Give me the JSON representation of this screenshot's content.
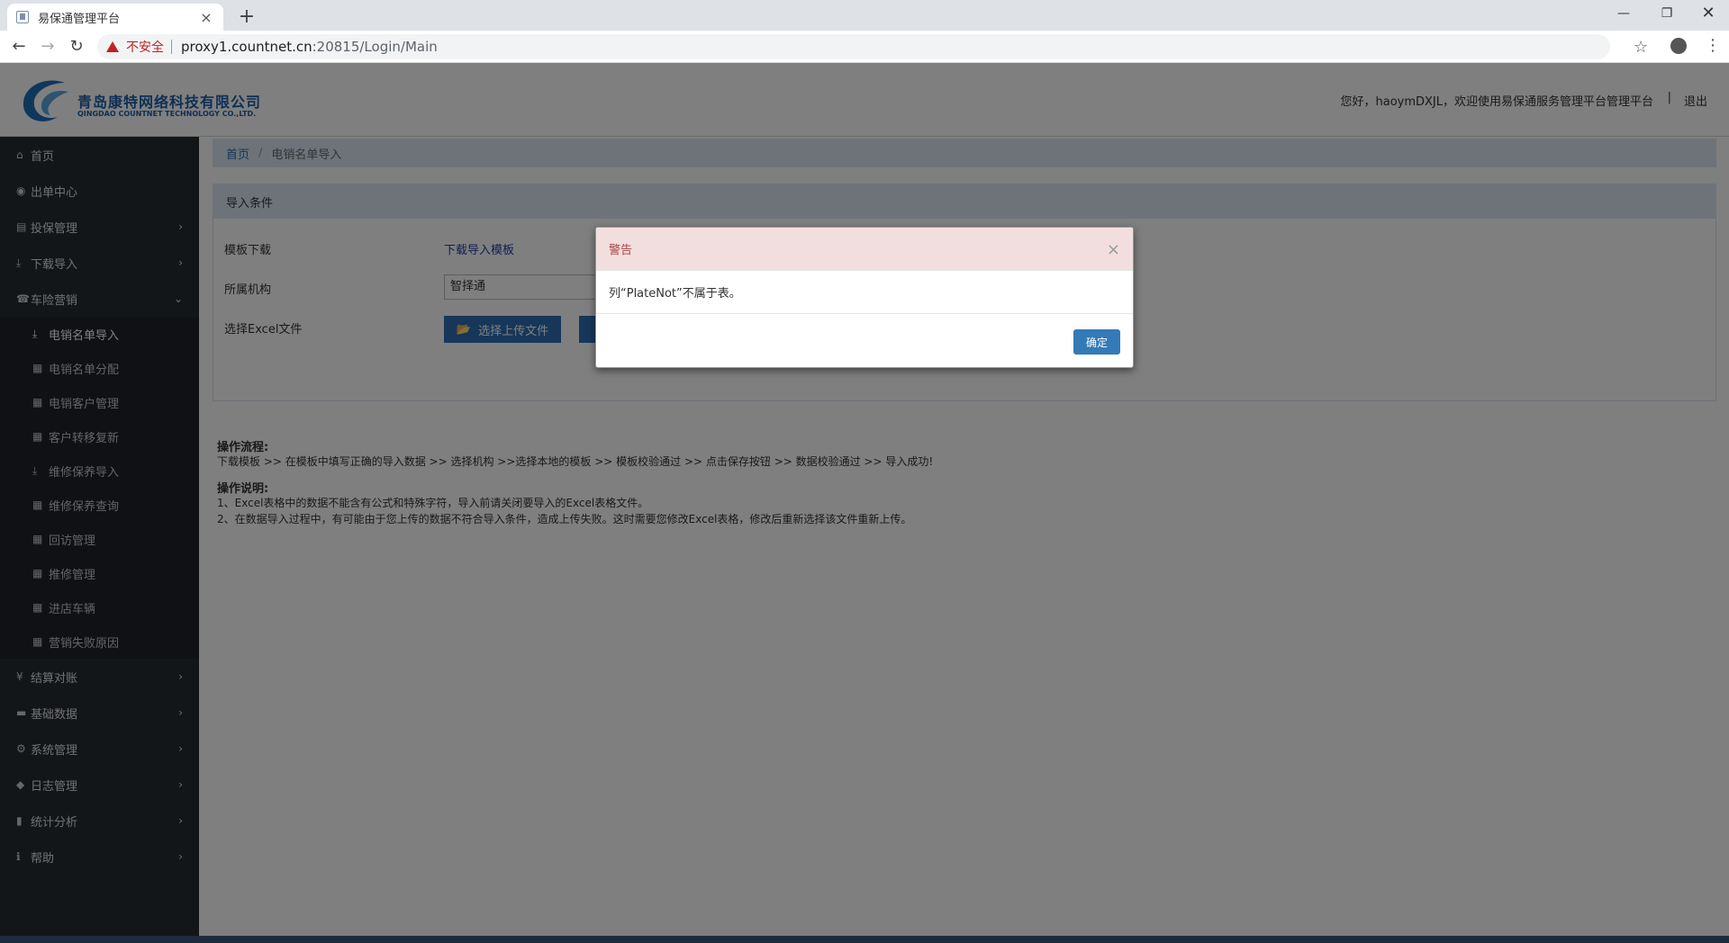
{
  "browser": {
    "tab_title": "易保通管理平台",
    "security_label": "不安全",
    "url_host": "proxy1.countnet.cn",
    "url_path": ":20815/Login/Main"
  },
  "header": {
    "company_cn": "青岛康特网络科技有限公司",
    "company_en": "QINGDAO COUNTNET TECHNOLOGY CO.,LTD.",
    "greeting": "您好，haoymDXJL，欢迎使用易保通服务管理平台管理平台",
    "separator": "|",
    "logout": "退出"
  },
  "sidebar": {
    "items": [
      {
        "label": "首页"
      },
      {
        "label": "出单中心"
      },
      {
        "label": "投保管理"
      },
      {
        "label": "下载导入"
      },
      {
        "label": "车险营销"
      }
    ],
    "sub_items": [
      {
        "label": "电销名单导入"
      },
      {
        "label": "电销名单分配"
      },
      {
        "label": "电销客户管理"
      },
      {
        "label": "客户转移复新"
      },
      {
        "label": "维修保养导入"
      },
      {
        "label": "维修保养查询"
      },
      {
        "label": "回访管理"
      },
      {
        "label": "推修管理"
      },
      {
        "label": "进店车辆"
      },
      {
        "label": "营销失败原因"
      }
    ],
    "bottom_items": [
      {
        "label": "结算对账"
      },
      {
        "label": "基础数据"
      },
      {
        "label": "系统管理"
      },
      {
        "label": "日志管理"
      },
      {
        "label": "统计分析"
      },
      {
        "label": "帮助"
      }
    ]
  },
  "breadcrumb": {
    "home": "首页",
    "sep": "/",
    "current": "电销名单导入"
  },
  "panel": {
    "title": "导入条件",
    "template_label": "模板下载",
    "template_link": "下载导入模板",
    "org_label": "所属机构",
    "org_value": "智择通",
    "file_label": "选择Excel文件",
    "upload_button": "选择上传文件"
  },
  "instructions": {
    "flow_title": "操作流程:",
    "flow_text": "下载模板 >> 在模板中填写正确的导入数据 >> 选择机构 >>选择本地的模板 >> 模板校验通过 >> 点击保存按钮 >> 数据校验通过 >> 导入成功!",
    "note_title": "操作说明:",
    "note_1": "1、Excel表格中的数据不能含有公式和特殊字符，导入前请关闭要导入的Excel表格文件。",
    "note_2": "2、在数据导入过程中，有可能由于您上传的数据不符合导入条件，造成上传失败。这时需要您修改Excel表格，修改后重新选择该文件重新上传。"
  },
  "modal": {
    "title": "警告",
    "close": "×",
    "message": "列“PlateNot”不属于表。",
    "ok_button": "确定"
  }
}
